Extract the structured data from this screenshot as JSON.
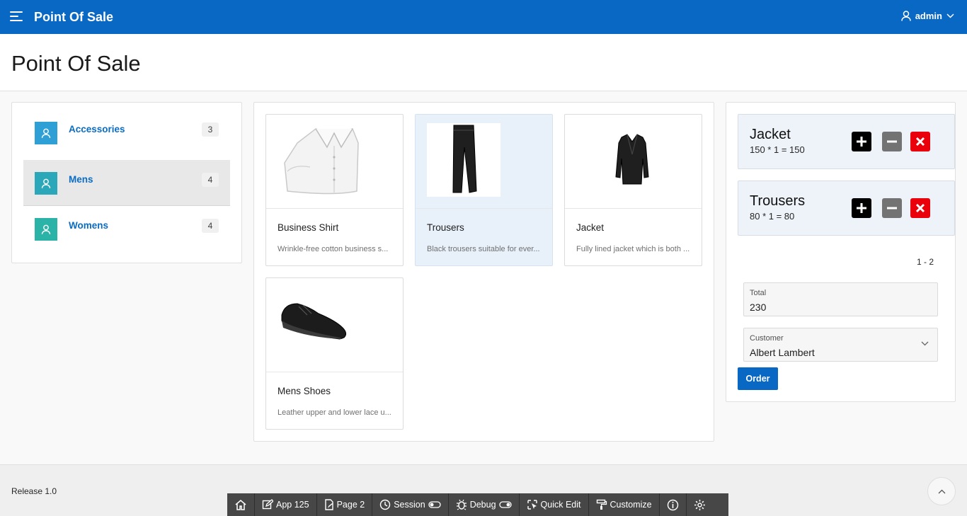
{
  "header": {
    "app_title": "Point Of Sale",
    "user_name": "admin"
  },
  "page": {
    "title": "Point Of Sale"
  },
  "categories": [
    {
      "label": "Accessories",
      "count": "3",
      "icon": "user-icon",
      "color": "#2ea0d6",
      "active": false
    },
    {
      "label": "Mens",
      "count": "4",
      "icon": "user-icon",
      "color": "#2aa7b9",
      "active": true
    },
    {
      "label": "Womens",
      "count": "4",
      "icon": "user-icon",
      "color": "#2bb3a8",
      "active": false
    }
  ],
  "products": [
    {
      "name": "Business Shirt",
      "description": "Wrinkle-free cotton business s...",
      "image": "shirt-image",
      "selected": false
    },
    {
      "name": "Trousers",
      "description": "Black trousers suitable for ever...",
      "image": "trousers-image",
      "selected": true
    },
    {
      "name": "Jacket",
      "description": "Fully lined jacket which is both ...",
      "image": "jacket-image",
      "selected": false
    },
    {
      "name": "Mens Shoes",
      "description": "Leather upper and lower lace u...",
      "image": "shoes-image",
      "selected": false
    }
  ],
  "cart": {
    "items": [
      {
        "name": "Jacket",
        "calc": "150 * 1 = 150"
      },
      {
        "name": "Trousers",
        "calc": "80 * 1 = 80"
      }
    ],
    "pagination": "1 - 2",
    "total_label": "Total",
    "total_value": "230",
    "customer_label": "Customer",
    "customer_value": "Albert Lambert",
    "order_label": "Order"
  },
  "footer": {
    "release": "Release 1.0"
  },
  "devbar": {
    "items": [
      {
        "label": "",
        "icon": "home-icon"
      },
      {
        "label": "App 125",
        "icon": "edit-icon"
      },
      {
        "label": "Page 2",
        "icon": "page-icon"
      },
      {
        "label": "Session",
        "icon": "session-icon"
      },
      {
        "label": "Debug",
        "icon": "bug-icon"
      },
      {
        "label": "Quick Edit",
        "icon": "quick-edit-icon"
      },
      {
        "label": "Customize",
        "icon": "paint-roller-icon"
      },
      {
        "label": "",
        "icon": "info-icon"
      },
      {
        "label": "",
        "icon": "gear-icon"
      }
    ]
  },
  "colors": {
    "brand": "#0868c4",
    "plus": "#000000",
    "minus": "#737373",
    "delete": "#e9000a"
  }
}
